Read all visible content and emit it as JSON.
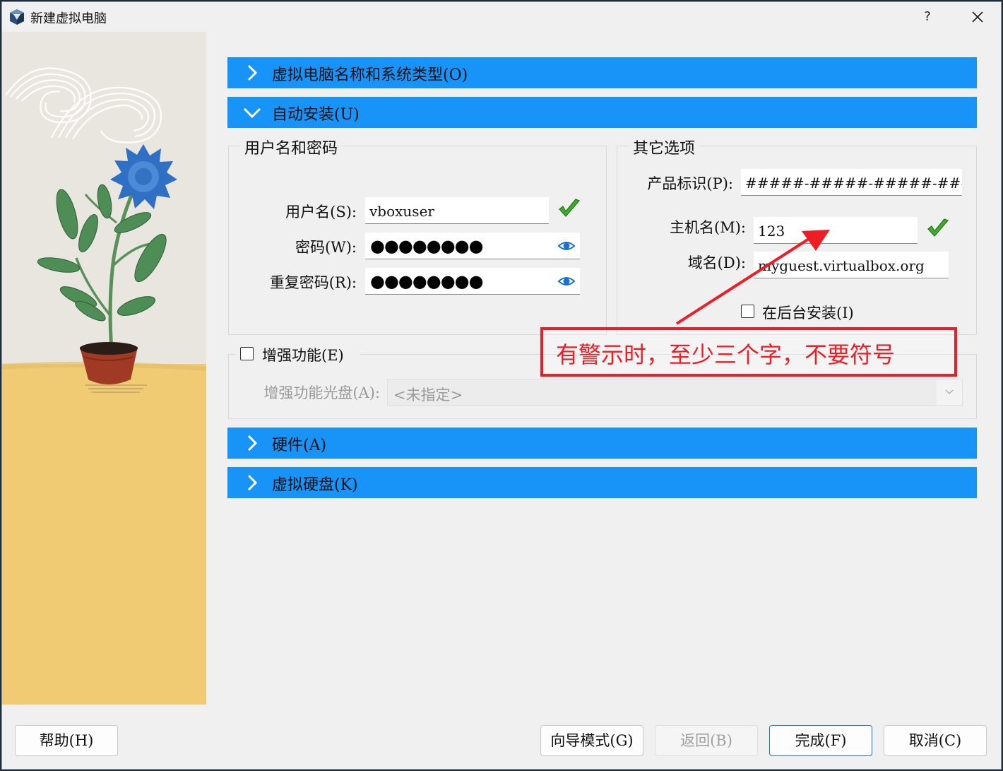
{
  "window": {
    "title": "新建虚拟电脑",
    "help_label": "?",
    "icon": "virtualbox-cube-icon"
  },
  "sections": {
    "name_os": "虚拟电脑名称和系统类型(O)",
    "unattended": "自动安装(U)",
    "hardware": "硬件(A)",
    "disk": "虚拟硬盘(K)"
  },
  "user_group": {
    "title": "用户名和密码",
    "username_label": "用户名(S):",
    "username_value": "vboxuser",
    "password_label": "密码(W):",
    "password_value": "●●●●●●●●",
    "repeat_label": "重复密码(R):",
    "repeat_value": "●●●●●●●●"
  },
  "other_group": {
    "title": "其它选项",
    "product_key_label": "产品标识(P):",
    "product_key_value": "#####-#####-#####-#####-##",
    "hostname_label": "主机名(M):",
    "hostname_value": "123",
    "domain_label": "域名(D):",
    "domain_value": "myguest.virtualbox.org",
    "background_install_label": "在后台安装(I)",
    "background_install_checked": false
  },
  "guest_additions": {
    "label": "增强功能(E)",
    "checked": false,
    "iso_label": "增强功能光盘(A):",
    "iso_value": "<未指定>"
  },
  "annotation": {
    "text": "有警示时，至少三个字，不要符号",
    "color": "#ee1c25"
  },
  "buttons": {
    "help": "帮助(H)",
    "guided_mode": "向导模式(G)",
    "back": "返回(B)",
    "finish": "完成(F)",
    "cancel": "取消(C)"
  },
  "colors": {
    "section_header": "#1893f8",
    "valid_check": "#3fae2a"
  }
}
